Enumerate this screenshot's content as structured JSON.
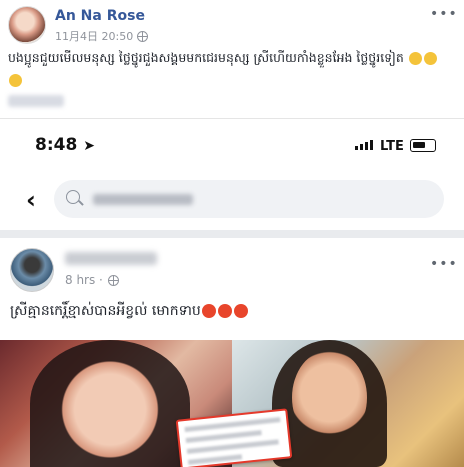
{
  "top_post": {
    "author": "An Na Rose",
    "timestamp": "11月4日 20:50",
    "body": "បងប្អូនជួយមើលមនុស្ស ថ្លៃថ្នូរជួងសង្គមមកជេរមនុស្ស ស្រីហើយកាំងខ្លួនអែង ថ្លៃថ្នូរទៀត"
  },
  "status_bar": {
    "time": "8:48",
    "network": "LTE"
  },
  "inner_post": {
    "meta": "8 hrs ·",
    "body": "ស្រីគ្មានកេរ្តិ៍ខ្មាស់បានអីខ្វល់ មោកទាប"
  },
  "icons": [
    "globe-icon",
    "more-options-icon",
    "back-arrow-icon",
    "search-icon",
    "location-arrow-icon",
    "signal-icon",
    "battery-icon"
  ],
  "colors": {
    "link": "#365899",
    "meta": "#90949c",
    "highlight": "#e5392b"
  }
}
